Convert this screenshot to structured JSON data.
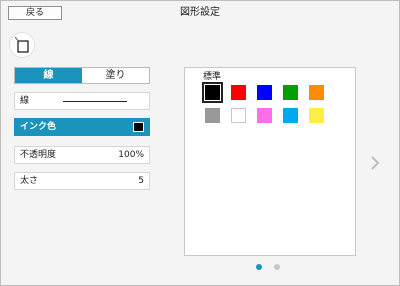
{
  "header": {
    "back_label": "戻る",
    "title": "図形設定"
  },
  "tabs": [
    {
      "label": "線",
      "active": true
    },
    {
      "label": "塗り",
      "active": false
    }
  ],
  "line_row": {
    "label": "線"
  },
  "ink_row": {
    "label": "インク色",
    "color": "#000000"
  },
  "opacity_row": {
    "label": "不透明度",
    "value": "100%"
  },
  "thickness_row": {
    "label": "太さ",
    "value": "5"
  },
  "palette": {
    "label": "標準",
    "selected": "black",
    "swatches": [
      {
        "name": "black",
        "color": "#000000"
      },
      {
        "name": "red",
        "color": "#ff0000"
      },
      {
        "name": "blue",
        "color": "#0000ff"
      },
      {
        "name": "green",
        "color": "#00a000"
      },
      {
        "name": "orange",
        "color": "#ff8c00"
      },
      {
        "name": "gray",
        "color": "#999999"
      },
      {
        "name": "white",
        "color": "#ffffff"
      },
      {
        "name": "pink",
        "color": "#ff6ee6"
      },
      {
        "name": "sky-blue",
        "color": "#00aaee"
      },
      {
        "name": "yellow",
        "color": "#ffee44"
      }
    ]
  },
  "pager": {
    "pages": 2,
    "current": 1
  },
  "colors": {
    "accent": "#1a93bd",
    "inactive_dot": "#c8c8c8",
    "arrow": "#bdbdbd"
  }
}
